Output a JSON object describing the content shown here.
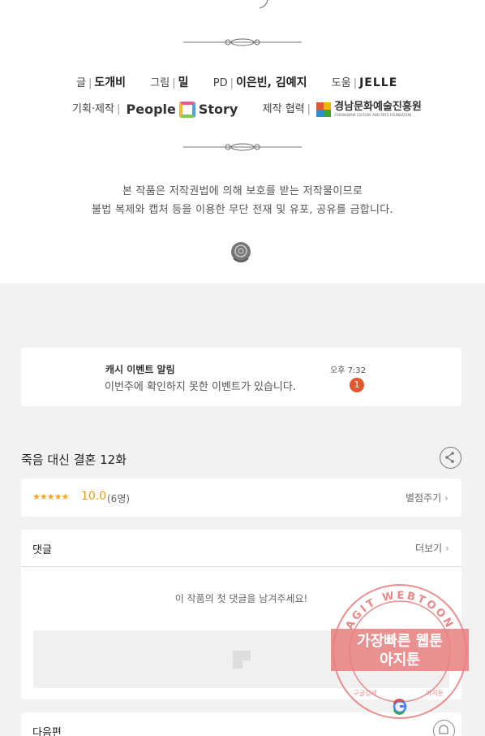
{
  "credits": {
    "writer_label": "글",
    "writer": "도개비",
    "artist_label": "그림",
    "artist": "밀",
    "pd_label": "PD",
    "pd": "이은빈, 김예지",
    "assist_label": "도움",
    "assist": "JELLE",
    "planning_label": "기획·제작",
    "planning_brand_left": "People",
    "planning_brand_right": "Story",
    "partner_label": "제작 협력",
    "partner_name": "경남문화예술진흥원",
    "partner_sub": "GYEONGNAM CULTURE AND ARTS FOUNDATION"
  },
  "copyright": {
    "line1": "본 작품은 저작권법에 의해 보호를 받는 저작물이므로",
    "line2": "불법 복제와 캡처 등을 이용한 무단 전재 및 유포, 공유를 금합니다."
  },
  "notification": {
    "title": "캐시 이벤트 알림",
    "message": "이번주에 확인하지 못한 이벤트가 있습니다.",
    "time": "오후 7:32",
    "count": "1"
  },
  "episode": {
    "title": "죽음 대신 결혼 12화"
  },
  "rating": {
    "stars": "★★★★★",
    "score": "10.0",
    "count": "(6명)",
    "action": "별점주기"
  },
  "comments": {
    "header": "댓글",
    "more": "더보기",
    "empty": "이 작품의 첫 댓글을 남겨주세요!"
  },
  "next": {
    "label": "다음편"
  },
  "watermark": {
    "ring_text": "AGIT WEBTOON",
    "line1": "가장빠른 웹툰",
    "line2": "아지툰",
    "bottom_left": "구글검색",
    "bottom_right": "아지툰"
  },
  "colors": {
    "star": "#f5a623",
    "badge": "#e4572e",
    "stamp": "#e57373"
  }
}
